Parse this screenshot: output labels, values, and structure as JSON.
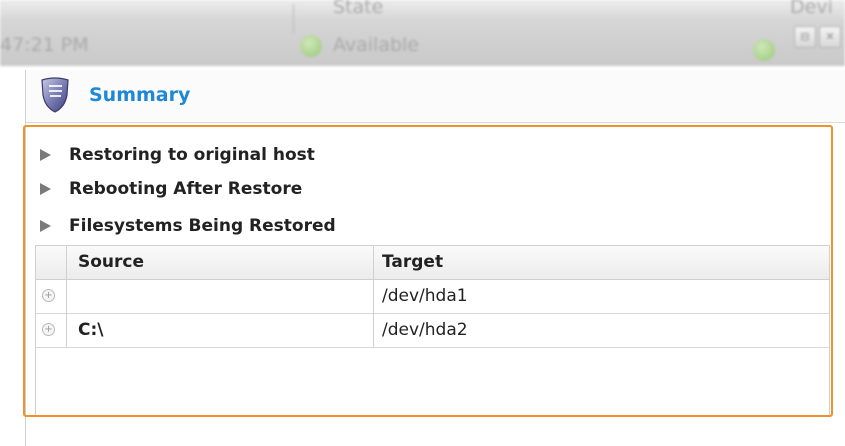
{
  "background_window": {
    "state_label": "State",
    "state_value": "Available",
    "time_text": "47:21 PM",
    "device_label": "Devi"
  },
  "summary": {
    "title": "Summary",
    "sections": [
      {
        "label": "Restoring to original host"
      },
      {
        "label": "Rebooting After Restore"
      },
      {
        "label": "Filesystems Being Restored"
      }
    ],
    "table": {
      "columns": [
        "Source",
        "Target"
      ],
      "rows": [
        {
          "source": "",
          "target": "/dev/hda1"
        },
        {
          "source": "C:\\",
          "target": "/dev/hda2"
        }
      ]
    }
  },
  "colors": {
    "accent": "#1e88d6",
    "highlight_border": "#f0922b"
  },
  "icons": {
    "header": "shield-icon",
    "section": "triangle-right-icon",
    "row_toggle": "plus-circle-icon"
  }
}
